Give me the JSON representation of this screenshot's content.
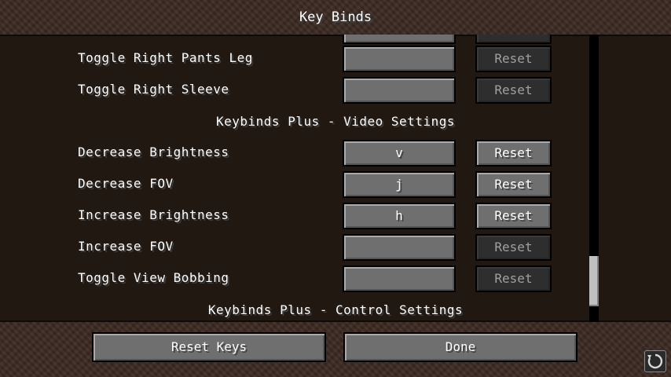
{
  "title": "Key Binds",
  "rows": [
    {
      "label": "Toggle Right Pants Leg",
      "key": "",
      "reset": "Reset",
      "reset_enabled": false
    },
    {
      "label": "Toggle Right Sleeve",
      "key": "",
      "reset": "Reset",
      "reset_enabled": false
    },
    {
      "label": "Decrease Brightness",
      "key": "v",
      "reset": "Reset",
      "reset_enabled": true
    },
    {
      "label": "Decrease FOV",
      "key": "j",
      "reset": "Reset",
      "reset_enabled": true
    },
    {
      "label": "Increase Brightness",
      "key": "h",
      "reset": "Reset",
      "reset_enabled": true
    },
    {
      "label": "Increase FOV",
      "key": "",
      "reset": "Reset",
      "reset_enabled": false
    },
    {
      "label": "Toggle View Bobbing",
      "key": "",
      "reset": "Reset",
      "reset_enabled": false
    }
  ],
  "categories": {
    "video": "Keybinds Plus - Video Settings",
    "control": "Keybinds Plus - Control Settings"
  },
  "buttons": {
    "reset_keys": "Reset Keys",
    "done": "Done"
  },
  "icons": {
    "corner": "refresh-icon"
  },
  "scroll": {
    "position_fraction": 0.9
  }
}
